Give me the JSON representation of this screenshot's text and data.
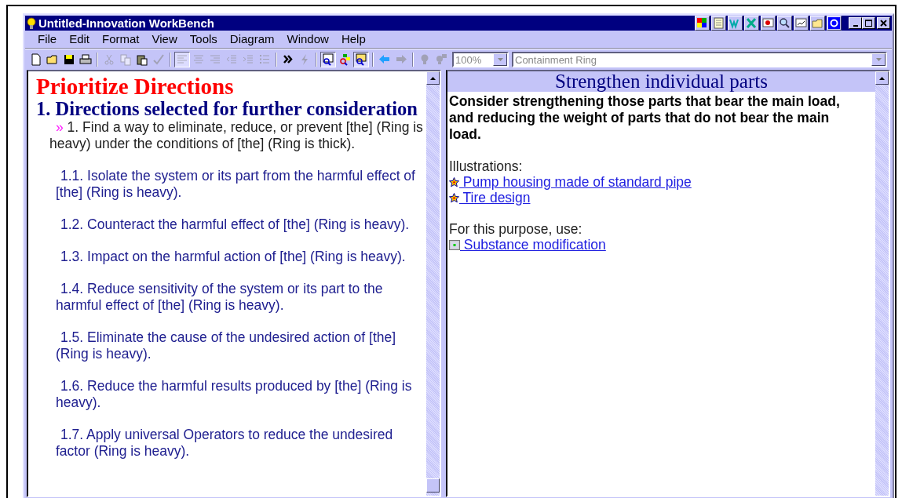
{
  "window": {
    "title": "Untitled-Innovation WorkBench"
  },
  "menu": [
    {
      "label": "File"
    },
    {
      "label": "Edit"
    },
    {
      "label": "Format"
    },
    {
      "label": "View"
    },
    {
      "label": "Tools"
    },
    {
      "label": "Diagram"
    },
    {
      "label": "Window"
    },
    {
      "label": "Help"
    }
  ],
  "toolbar": {
    "buttons": [
      {
        "disabled": false,
        "pressed": false
      },
      {
        "disabled": false,
        "pressed": false
      },
      {
        "disabled": false,
        "pressed": false
      },
      {
        "disabled": false,
        "pressed": false
      },
      {
        "disabled": true,
        "pressed": false
      },
      {
        "disabled": true,
        "pressed": false
      },
      {
        "disabled": false,
        "pressed": false
      },
      {
        "disabled": true,
        "pressed": false
      },
      {
        "disabled": true,
        "pressed": true
      },
      {
        "disabled": true,
        "pressed": false
      },
      {
        "disabled": true,
        "pressed": false
      },
      {
        "disabled": true,
        "pressed": false
      },
      {
        "disabled": true,
        "pressed": false
      },
      {
        "disabled": true,
        "pressed": false
      },
      {
        "disabled": false,
        "pressed": false
      },
      {
        "disabled": true,
        "pressed": false
      },
      {
        "disabled": false,
        "pressed": true
      },
      {
        "disabled": false,
        "pressed": false
      },
      {
        "disabled": false,
        "pressed": true
      },
      {
        "disabled": false,
        "pressed": false
      },
      {
        "disabled": true,
        "pressed": false
      },
      {
        "disabled": true,
        "pressed": false
      },
      {
        "disabled": true,
        "pressed": false
      }
    ],
    "zoom": {
      "value": "100%",
      "disabled": true
    },
    "topic": {
      "value": "Containment Ring",
      "disabled": true
    }
  },
  "left_pane": {
    "title": "Prioritize Directions",
    "heading": "1. Directions selected for further consideration",
    "items": [
      {
        "kind": "current",
        "marker": "»",
        "text": "1. Find a way to eliminate, reduce, or prevent [the] (Ring is heavy) under the conditions of [the] (Ring is thick)."
      },
      {
        "kind": "sub",
        "text": "1.1. Isolate the system or its part from the harmful effect of [the] (Ring is heavy)."
      },
      {
        "kind": "sub",
        "text": "1.2. Counteract the harmful effect of [the] (Ring is heavy)."
      },
      {
        "kind": "sub",
        "text": "1.3. Impact on the harmful action of [the]  (Ring is heavy)."
      },
      {
        "kind": "sub",
        "text": "1.4. Reduce sensitivity of the system or its part to the harmful effect of [the] (Ring is heavy)."
      },
      {
        "kind": "sub",
        "text": "1.5. Eliminate the cause of the undesired action of [the] (Ring is heavy)."
      },
      {
        "kind": "sub",
        "text": "1.6. Reduce the harmful results produced by [the] (Ring is heavy)."
      },
      {
        "kind": "sub",
        "text": "1.7. Apply universal Operators to reduce the undesired factor (Ring is heavy)."
      }
    ]
  },
  "right_pane": {
    "header": "Strengthen individual parts",
    "summary": "Consider strengthening those parts that bear the main load, and reducing the weight of parts that do not bear the main load.",
    "sections": [
      {
        "label": "Illustrations:",
        "links": [
          {
            "kind": "example",
            "text": " Pump housing made of standard pipe"
          },
          {
            "kind": "example",
            "text": " Tire design"
          }
        ]
      },
      {
        "label": "For this purpose, use:",
        "links": [
          {
            "kind": "tool",
            "text": " Substance modification"
          }
        ]
      }
    ]
  }
}
